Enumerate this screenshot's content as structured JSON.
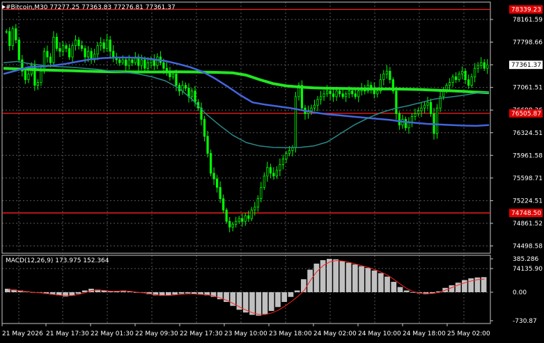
{
  "header": {
    "symbol_title": "#Bitcoin,M30",
    "ohlc": "77277.25 77363.83 77276.81 77361.37"
  },
  "colors": {
    "background": "#000000",
    "grid": "#5a5a5a",
    "frame": "#c8c8c8",
    "text": "#ffffff",
    "candle": "#00ff00",
    "ma_green": "#22e622",
    "ma_blue": "#4466dd",
    "ma_teal": "#2a8a8a",
    "level_line": "#ff2020",
    "level_label_bg": "#e00000",
    "price_label_bg": "#ffffff",
    "macd_hist": "#c0c0c0",
    "macd_signal": "#ff2020"
  },
  "chart_data": [
    {
      "type": "candlestick",
      "symbol": "#Bitcoin",
      "timeframe": "M30",
      "ylim": [
        74135.9,
        78339.2
      ],
      "y_ticks": [
        "78161.59",
        "77798.66",
        "77424.59",
        "77061.51",
        "76698.36",
        "76324.51",
        "75961.58",
        "75598.71",
        "75224.51",
        "74861.52",
        "74498.58",
        "74135.90"
      ],
      "x_ticks": [
        "21 May 2026",
        "21 May 17:30",
        "22 May 01:30",
        "22 May 09:30",
        "22 May 17:30",
        "23 May 10:00",
        "23 May 18:00",
        "24 May 02:00",
        "24 May 10:00",
        "24 May 18:00",
        "25 May 02:00"
      ],
      "current_price": "77361.37",
      "horizontal_levels": [
        {
          "value": 78339.23,
          "label": "78339.23"
        },
        {
          "value": 76505.87,
          "label": "76505.87"
        },
        {
          "value": 74748.5,
          "label": "74748.50"
        }
      ],
      "close_series": [
        77950,
        77700,
        78000,
        77800,
        77450,
        77250,
        77100,
        77200,
        77350,
        77000,
        77050,
        77250,
        77600,
        77500,
        77400,
        77850,
        77650,
        77600,
        77700,
        77650,
        77500,
        77700,
        77800,
        77700,
        77650,
        77500,
        77600,
        77450,
        77550,
        77700,
        77750,
        77650,
        77800,
        77600,
        77500,
        77450,
        77400,
        77450,
        77350,
        77450,
        77400,
        77500,
        77350,
        77450,
        77300,
        77400,
        77450,
        77350,
        77500,
        77400,
        77300,
        77250,
        77150,
        77200,
        77000,
        76900,
        77000,
        76950,
        76800,
        76900,
        76700,
        76600,
        76400,
        76100,
        75800,
        75450,
        75350,
        75200,
        75000,
        74800,
        74600,
        74500,
        74550,
        74600,
        74650,
        74600,
        74700,
        74650,
        74800,
        74850,
        75000,
        75200,
        75400,
        75550,
        75450,
        75400,
        75500,
        75600,
        75700,
        75800,
        75850,
        75900,
        76800,
        77000,
        76600,
        76500,
        76550,
        76600,
        76650,
        76750,
        76800,
        76850,
        76900,
        76850,
        76800,
        76900,
        76850,
        76800,
        76850,
        76900,
        76850,
        76800,
        76900,
        76950,
        76900,
        77000,
        76950,
        76850,
        76900,
        77100,
        77200,
        77250,
        77100,
        76900,
        76500,
        76300,
        76400,
        76250,
        76350,
        76450,
        76500,
        76550,
        76600,
        76650,
        76700,
        76500,
        76150,
        76600,
        76800,
        76900,
        77000,
        77050,
        77150,
        77100,
        77200,
        77250,
        77100,
        77000,
        77150,
        77300,
        77350,
        77400,
        77300,
        77361
      ],
      "moving_averages": [
        {
          "color": "#22e622",
          "values": [
            77300,
            77290,
            77280,
            77270,
            77265,
            77258,
            77250,
            77245,
            77240,
            77238,
            77236,
            77235,
            77236,
            77237,
            77236,
            77232,
            77228,
            77220,
            77180,
            77100,
            77030,
            76990,
            76970,
            76955,
            76948,
            76945,
            76940,
            76938,
            76936,
            76935,
            76932,
            76925,
            76915,
            76905,
            76895,
            76880,
            76870
          ]
        },
        {
          "color": "#4466dd",
          "values": [
            77200,
            77260,
            77320,
            77330,
            77350,
            77380,
            77420,
            77460,
            77480,
            77490,
            77490,
            77485,
            77460,
            77430,
            77380,
            77320,
            77240,
            77120,
            76980,
            76830,
            76700,
            76660,
            76630,
            76600,
            76560,
            76520,
            76490,
            76470,
            76450,
            76430,
            76410,
            76390,
            76360,
            76340,
            76320,
            76310,
            76300,
            76290,
            76285,
            76300
          ]
        },
        {
          "color": "#2a8a8a",
          "values": [
            77400,
            77420,
            77380,
            77350,
            77330,
            77320,
            77300,
            77280,
            77250,
            77230,
            77200,
            77150,
            77080,
            76950,
            76750,
            76500,
            76300,
            76120,
            75990,
            75930,
            75905,
            75900,
            75905,
            75930,
            76000,
            76150,
            76300,
            76420,
            76520,
            76590,
            76640,
            76700,
            76760,
            76790,
            76820,
            76860,
            76880
          ]
        }
      ]
    },
    {
      "type": "bar",
      "indicator": "MACD(12,26,9)",
      "readout": "173.975 152.364",
      "y_ticks": [
        "385.286",
        "0.00",
        "-730.87"
      ],
      "ylim": [
        -730.87,
        385.286
      ],
      "macd_values": [
        40,
        30,
        20,
        10,
        -10,
        -20,
        -40,
        -60,
        -80,
        -110,
        -90,
        -40,
        20,
        40,
        30,
        20,
        10,
        15,
        20,
        10,
        -5,
        -20,
        -50,
        -80,
        -90,
        -85,
        -60,
        -40,
        -30,
        -40,
        -60,
        -80,
        -120,
        -180,
        -250,
        -350,
        -450,
        -520,
        -580,
        -600,
        -560,
        -480,
        -380,
        -250,
        -120,
        20,
        150,
        260,
        330,
        370,
        385,
        380,
        360,
        340,
        320,
        300,
        280,
        250,
        220,
        180,
        120,
        60,
        20,
        -10,
        -30,
        -50,
        -30,
        10,
        50,
        80,
        110,
        140,
        160,
        170,
        174
      ],
      "signal_values": [
        30,
        25,
        15,
        5,
        -5,
        -15,
        -35,
        -55,
        -75,
        -90,
        -85,
        -55,
        -10,
        20,
        25,
        20,
        12,
        12,
        15,
        10,
        0,
        -15,
        -40,
        -65,
        -80,
        -82,
        -70,
        -55,
        -45,
        -45,
        -55,
        -70,
        -100,
        -150,
        -210,
        -290,
        -380,
        -460,
        -530,
        -570,
        -570,
        -530,
        -460,
        -360,
        -240,
        -110,
        20,
        140,
        240,
        310,
        350,
        365,
        360,
        345,
        325,
        305,
        285,
        260,
        230,
        195,
        145,
        90,
        40,
        5,
        -20,
        -35,
        -30,
        -5,
        25,
        55,
        85,
        110,
        130,
        145,
        152
      ]
    }
  ]
}
